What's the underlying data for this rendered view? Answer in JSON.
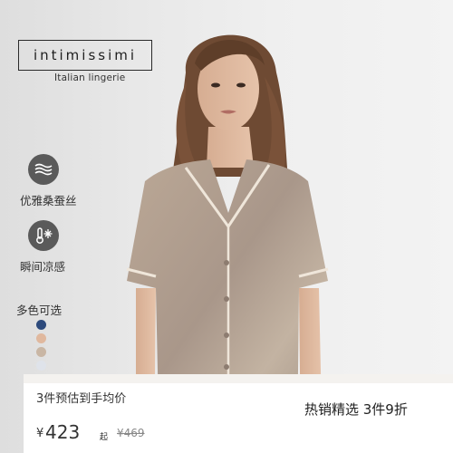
{
  "brand": {
    "name": "intimissimi",
    "tagline": "Italian lingerie"
  },
  "features": [
    {
      "icon": "silk-waves-icon",
      "label": "优雅桑蚕丝"
    },
    {
      "icon": "cooling-thermometer-icon",
      "label": "瞬间凉感"
    }
  ],
  "colors": {
    "title": "多色可选",
    "swatches": [
      "#2d4a7c",
      "#e0b89e",
      "#c9b6a4",
      "#dfe3ea"
    ]
  },
  "promo": {
    "left_title": "3件预估到手均价",
    "currency": "¥",
    "price": "423",
    "price_unit": "起",
    "original_price": "¥469",
    "right_text": "热销精选  3件9折"
  }
}
